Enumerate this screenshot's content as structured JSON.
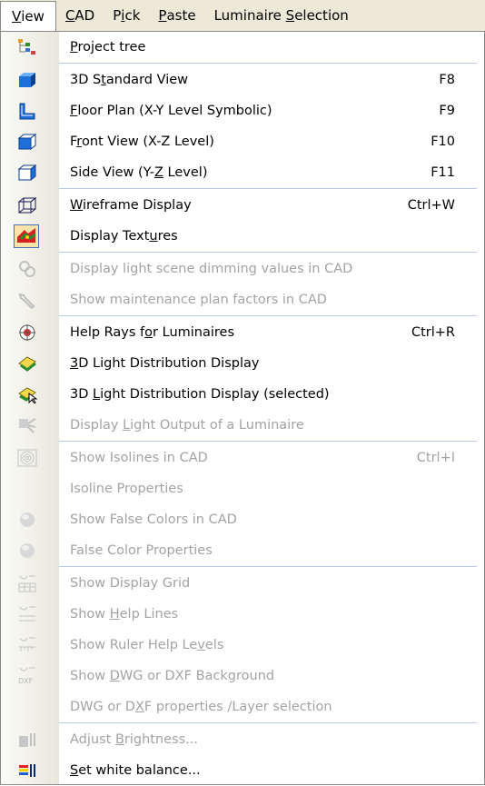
{
  "menubar": {
    "items": [
      {
        "pre": "",
        "acc": "V",
        "post": "iew",
        "active": true
      },
      {
        "pre": "",
        "acc": "C",
        "post": "AD",
        "active": false
      },
      {
        "pre": "P",
        "acc": "i",
        "post": "ck",
        "active": false
      },
      {
        "pre": "",
        "acc": "P",
        "post": "aste",
        "active": false
      },
      {
        "pre": "Luminaire ",
        "acc": "S",
        "post": "election",
        "active": false
      }
    ]
  },
  "menu": {
    "items": [
      {
        "type": "item",
        "icon": "project-tree-icon",
        "pre": "",
        "acc": "P",
        "post": "roject tree",
        "shortcut": "",
        "disabled": false
      },
      {
        "type": "sep"
      },
      {
        "type": "item",
        "icon": "3d-cube-icon",
        "pre": "3D S",
        "acc": "t",
        "post": "andard View",
        "shortcut": "F8",
        "disabled": false
      },
      {
        "type": "item",
        "icon": "floor-plan-icon",
        "pre": "",
        "acc": "F",
        "post": "loor Plan (X-Y Level Symbolic)",
        "shortcut": "F9",
        "disabled": false
      },
      {
        "type": "item",
        "icon": "front-view-icon",
        "pre": "F",
        "acc": "r",
        "post": "ont View (X-Z Level)",
        "shortcut": "F10",
        "disabled": false
      },
      {
        "type": "item",
        "icon": "side-view-icon",
        "pre": "Side View (Y-",
        "acc": "Z",
        "post": " Level)",
        "shortcut": "F11",
        "disabled": false
      },
      {
        "type": "sep"
      },
      {
        "type": "item",
        "icon": "wireframe-icon",
        "pre": "",
        "acc": "W",
        "post": "ireframe Display",
        "shortcut": "Ctrl+W",
        "disabled": false
      },
      {
        "type": "item",
        "icon": "textures-icon",
        "pre": "Display Text",
        "acc": "u",
        "post": "res",
        "shortcut": "",
        "disabled": false,
        "checked": true
      },
      {
        "type": "sep"
      },
      {
        "type": "item",
        "icon": "dimming-icon",
        "pre": "Display light scene dimming values in CAD",
        "acc": "",
        "post": "",
        "shortcut": "",
        "disabled": true
      },
      {
        "type": "item",
        "icon": "wrench-icon",
        "pre": "Show maintenance plan factors in CAD",
        "acc": "",
        "post": "",
        "shortcut": "",
        "disabled": true
      },
      {
        "type": "sep"
      },
      {
        "type": "item",
        "icon": "help-rays-icon",
        "pre": "Help Rays f",
        "acc": "o",
        "post": "r Luminaires",
        "shortcut": "Ctrl+R",
        "disabled": false
      },
      {
        "type": "item",
        "icon": "light-distribution-icon",
        "pre": "",
        "acc": "3",
        "post": "D Light Distribution Display",
        "shortcut": "",
        "disabled": false
      },
      {
        "type": "item",
        "icon": "light-distribution-selected-icon",
        "pre": "3D ",
        "acc": "L",
        "post": "ight Distribution Display (selected)",
        "shortcut": "",
        "disabled": false
      },
      {
        "type": "item",
        "icon": "light-output-icon",
        "pre": "Display ",
        "acc": "L",
        "post": "ight Output of a Luminaire",
        "shortcut": "",
        "disabled": true
      },
      {
        "type": "sep"
      },
      {
        "type": "item",
        "icon": "isolines-icon",
        "pre": "Show Isolines in CAD",
        "acc": "",
        "post": "",
        "shortcut": "Ctrl+I",
        "disabled": true
      },
      {
        "type": "item",
        "icon": "",
        "pre": "Isoline Properties",
        "acc": "",
        "post": "",
        "shortcut": "",
        "disabled": true
      },
      {
        "type": "item",
        "icon": "false-colors-icon",
        "pre": "Show False Colors in CAD",
        "acc": "",
        "post": "",
        "shortcut": "",
        "disabled": true
      },
      {
        "type": "item",
        "icon": "false-color-properties-icon",
        "pre": "False Color Properties",
        "acc": "",
        "post": "",
        "shortcut": "",
        "disabled": true
      },
      {
        "type": "sep"
      },
      {
        "type": "item",
        "icon": "display-grid-icon",
        "pre": "Show Display Grid",
        "acc": "",
        "post": "",
        "shortcut": "",
        "disabled": true
      },
      {
        "type": "item",
        "icon": "help-lines-icon",
        "pre": "Show ",
        "acc": "H",
        "post": "elp Lines",
        "shortcut": "",
        "disabled": true
      },
      {
        "type": "item",
        "icon": "ruler-help-levels-icon",
        "pre": "Show Ruler Help Le",
        "acc": "v",
        "post": "els",
        "shortcut": "",
        "disabled": true
      },
      {
        "type": "item",
        "icon": "dxf-icon",
        "pre": "Show ",
        "acc": "D",
        "post": "WG or DXF Background",
        "shortcut": "",
        "disabled": true
      },
      {
        "type": "item",
        "icon": "",
        "pre": "DWG or D",
        "acc": "X",
        "post": "F properties /Layer selection",
        "shortcut": "",
        "disabled": true
      },
      {
        "type": "sep"
      },
      {
        "type": "item",
        "icon": "brightness-icon",
        "pre": "Adjust ",
        "acc": "B",
        "post": "rightness...",
        "shortcut": "",
        "disabled": true
      },
      {
        "type": "item",
        "icon": "white-balance-icon",
        "pre": "",
        "acc": "S",
        "post": "et white balance...",
        "shortcut": "",
        "disabled": false
      }
    ]
  }
}
